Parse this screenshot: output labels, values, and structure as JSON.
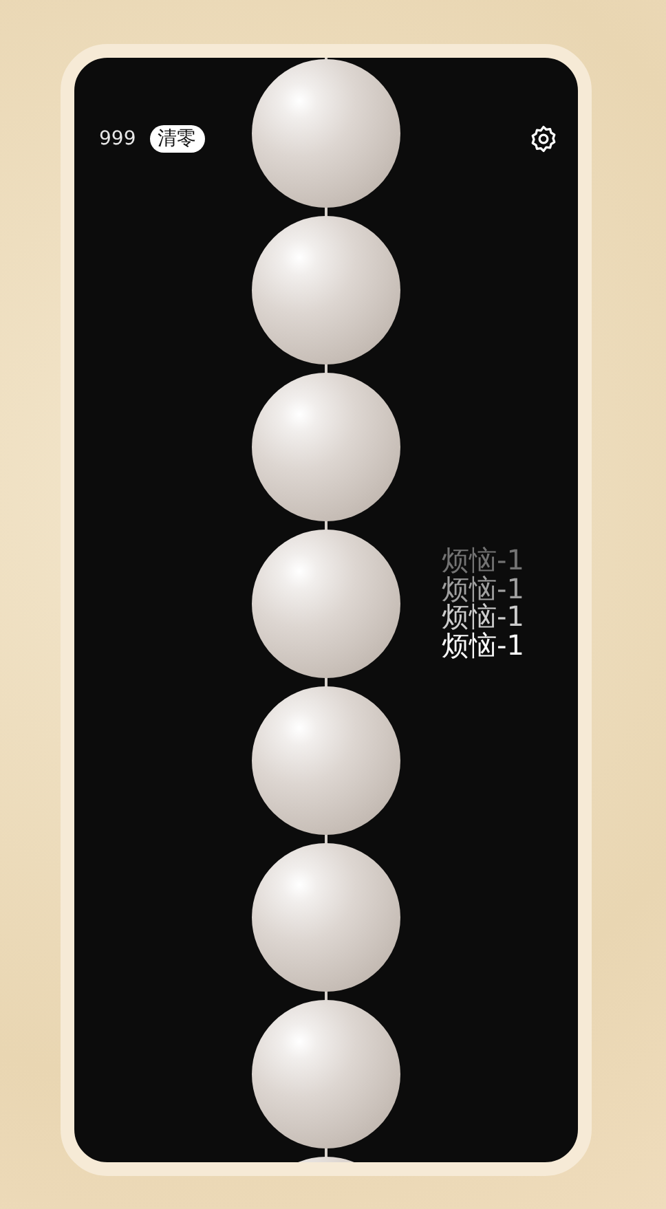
{
  "header": {
    "count": "999",
    "reset_button": "清零"
  },
  "floating_texts": [
    "烦恼-1",
    "烦恼-1",
    "烦恼-1",
    "烦恼-1"
  ]
}
